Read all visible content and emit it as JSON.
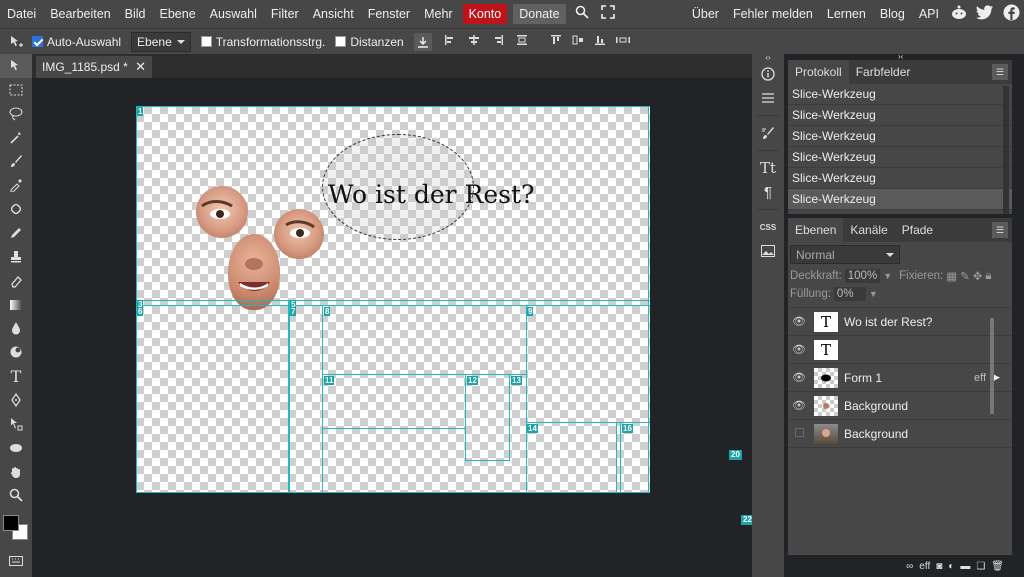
{
  "menu": {
    "items": [
      "Datei",
      "Bearbeiten",
      "Bild",
      "Ebene",
      "Auswahl",
      "Filter",
      "Ansicht",
      "Fenster",
      "Mehr"
    ],
    "konto": "Konto",
    "donate": "Donate",
    "right": [
      "Über",
      "Fehler melden",
      "Lernen",
      "Blog",
      "API"
    ]
  },
  "options": {
    "auto_select": "Auto-Auswahl",
    "auto_select_target": "Ebene",
    "transform": "Transformationsstrg.",
    "distances": "Distanzen"
  },
  "document": {
    "tab_name": "IMG_1185.psd *",
    "headline": "Wo ist der Rest?"
  },
  "slices": [
    "1",
    "3",
    "5",
    "6",
    "7",
    "8",
    "9",
    "11",
    "12",
    "13",
    "14",
    "16"
  ],
  "outside_slices": [
    "20",
    "22"
  ],
  "history": {
    "tabs": [
      "Protokoll",
      "Farbfelder"
    ],
    "items": [
      "Slice-Werkzeug",
      "Slice-Werkzeug",
      "Slice-Werkzeug",
      "Slice-Werkzeug",
      "Slice-Werkzeug",
      "Slice-Werkzeug"
    ]
  },
  "layers_panel": {
    "tabs": [
      "Ebenen",
      "Kanäle",
      "Pfade"
    ],
    "blend_mode": "Normal",
    "opacity_label": "Deckkraft:",
    "opacity_value": "100%",
    "lock_label": "Fixieren:",
    "fill_label": "Füllung:",
    "fill_value": "0%",
    "layers": [
      {
        "name": "Wo ist der Rest?",
        "thumb": "T",
        "visible": true
      },
      {
        "name": "",
        "thumb": "T",
        "visible": true
      },
      {
        "name": "Form 1",
        "thumb": "",
        "visible": true,
        "fx": "eff"
      },
      {
        "name": "Background",
        "thumb": "",
        "visible": true
      },
      {
        "name": "Background",
        "thumb": "",
        "visible": false
      }
    ]
  },
  "colors": {
    "accent": "#1ca3a8",
    "konto": "#c1121a"
  }
}
